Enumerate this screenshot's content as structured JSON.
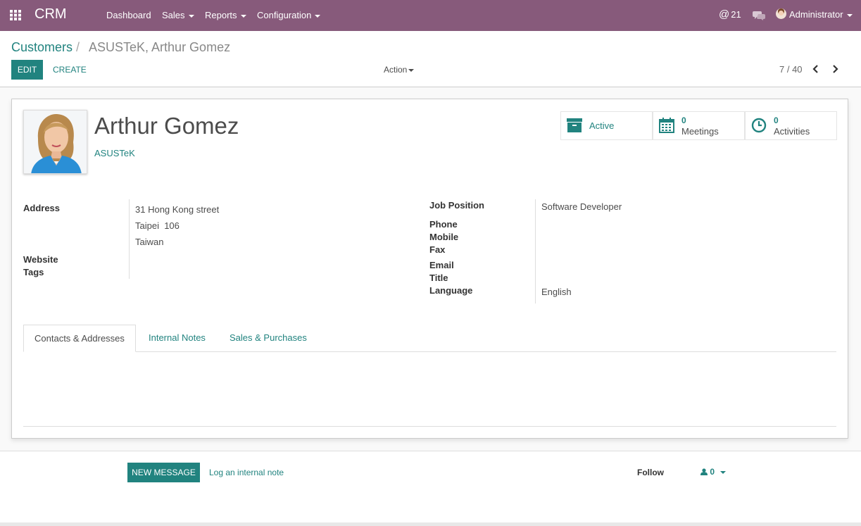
{
  "navbar": {
    "brand": "CRM",
    "menus": [
      "Dashboard",
      "Sales",
      "Reports",
      "Configuration"
    ],
    "mentions_count": "21",
    "user": "Administrator",
    "color": "#875a7b"
  },
  "breadcrumb": {
    "parent": "Customers",
    "separator": "/",
    "current": "ASUSTeK, Arthur Gomez"
  },
  "toolbar": {
    "edit_label": "EDIT",
    "create_label": "CREATE",
    "action_label": "Action",
    "pager": "7 / 40"
  },
  "contact": {
    "name": "Arthur Gomez",
    "company": "ASUSTeK"
  },
  "smart_buttons": {
    "active_label": "Active",
    "meetings_count": "0",
    "meetings_label": "Meetings",
    "activities_count": "0",
    "activities_label": "Activities"
  },
  "fields_left": {
    "address_label": "Address",
    "street": "31 Hong Kong street",
    "city_zip": "Taipei  106",
    "country": "Taiwan",
    "website_label": "Website",
    "tags_label": "Tags"
  },
  "fields_right": {
    "job_position_label": "Job Position",
    "job_position": "Software Developer",
    "phone_label": "Phone",
    "mobile_label": "Mobile",
    "fax_label": "Fax",
    "email_label": "Email",
    "title_label": "Title",
    "language_label": "Language",
    "language": "English"
  },
  "tabs": [
    "Contacts & Addresses",
    "Internal Notes",
    "Sales & Purchases"
  ],
  "chatter": {
    "new_message": "NEW MESSAGE",
    "log_note": "Log an internal note",
    "follow": "Follow",
    "followers_count": "0"
  },
  "accent_color": "#21837f"
}
